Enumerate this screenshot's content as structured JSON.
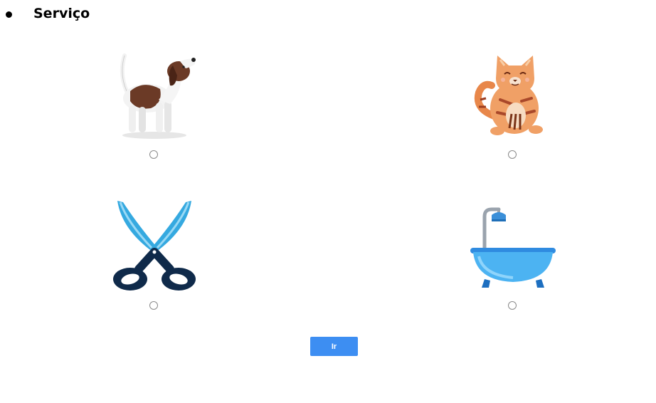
{
  "section": {
    "title": "Serviço"
  },
  "options": [
    {
      "icon": "dog-icon",
      "selected": false
    },
    {
      "icon": "cat-icon",
      "selected": false
    },
    {
      "icon": "scissors-icon",
      "selected": false
    },
    {
      "icon": "bathtub-icon",
      "selected": false
    }
  ],
  "submit": {
    "label": "Ir"
  },
  "colors": {
    "button": "#3d8ef2",
    "button_text": "#ffffff",
    "radio_border": "#8a8a8a"
  }
}
